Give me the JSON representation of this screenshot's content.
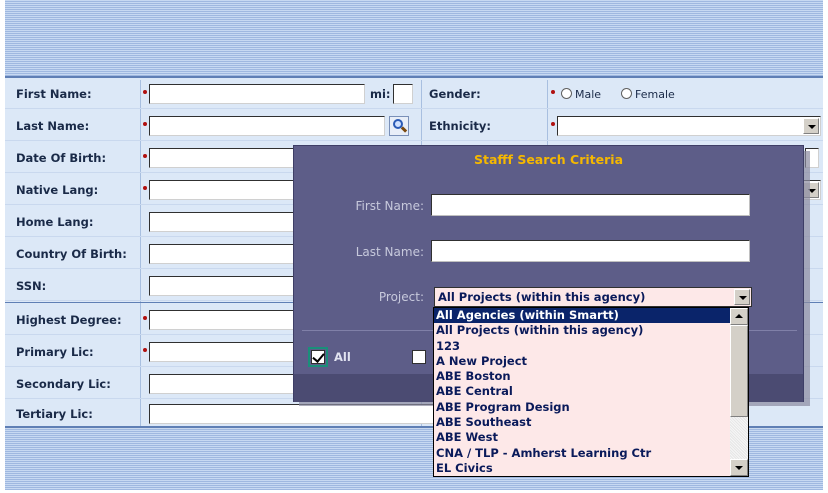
{
  "form": {
    "first_name_label": "First Name:",
    "mi_label": "mi:",
    "gender_label": "Gender:",
    "gender_male": "Male",
    "gender_female": "Female",
    "last_name_label": "Last Name:",
    "ethnicity_label": "Ethnicity:",
    "dob_label": "Date Of Birth:",
    "native_lang_label": "Native Lang:",
    "home_lang_label": "Home Lang:",
    "country_label": "Country Of Birth:",
    "ssn_label": "SSN:",
    "highest_degree_label": "Highest Degree:",
    "primary_lic_label": "Primary Lic:",
    "secondary_lic_label": "Secondary Lic:",
    "tertiary_lic_label": "Tertiary Lic:"
  },
  "modal": {
    "title": "Stafff Search Criteria",
    "first_name_label": "First Name:",
    "last_name_label": "Last Name:",
    "project_label": "Project:",
    "project_selected": "All Projects (within this agency)",
    "all_label": "All"
  },
  "dropdown": {
    "options": [
      "All Agencies (within Smartt)",
      "All Projects (within this agency)",
      "123",
      "A New Project",
      "ABE Boston",
      "ABE Central",
      "ABE Program Design",
      "ABE Southeast",
      "ABE West",
      "CNA / TLP - Amherst Learning Ctr",
      "EL Civics"
    ],
    "highlighted_index": 0
  },
  "colors": {
    "required_marker": "#b01010",
    "modal_bg": "#5d5d88",
    "modal_title": "#f5b800",
    "selection": "#0a246a"
  }
}
